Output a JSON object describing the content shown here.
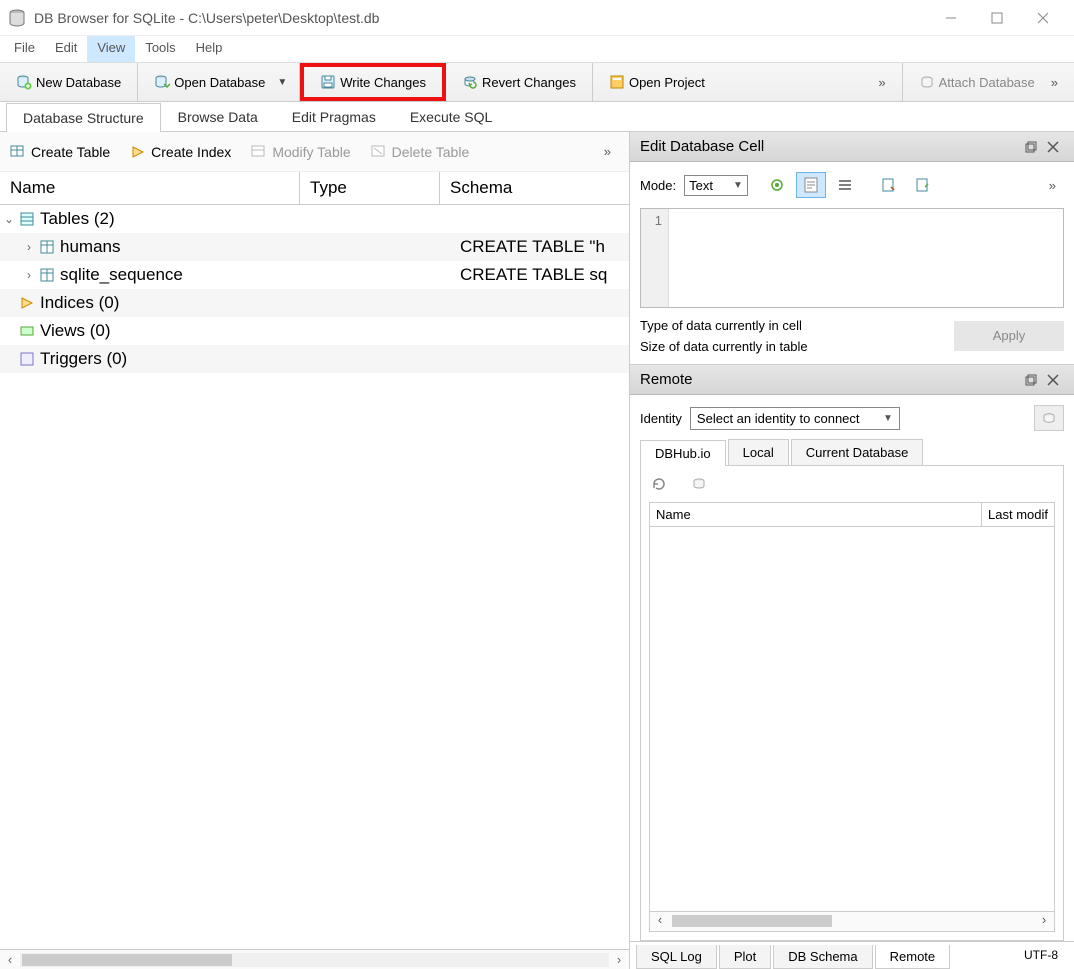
{
  "window": {
    "title": "DB Browser for SQLite - C:\\Users\\peter\\Desktop\\test.db"
  },
  "menu": {
    "file": "File",
    "edit": "Edit",
    "view": "View",
    "tools": "Tools",
    "help": "Help"
  },
  "toolbar": {
    "new_db": "New Database",
    "open_db": "Open Database",
    "write_changes": "Write Changes",
    "revert_changes": "Revert Changes",
    "open_project": "Open Project",
    "attach_db": "Attach Database"
  },
  "tabs": {
    "structure": "Database Structure",
    "browse": "Browse Data",
    "pragmas": "Edit Pragmas",
    "execute": "Execute SQL"
  },
  "subtoolbar": {
    "create_table": "Create Table",
    "create_index": "Create Index",
    "modify_table": "Modify Table",
    "delete_table": "Delete Table"
  },
  "tree": {
    "cols": {
      "name": "Name",
      "type": "Type",
      "schema": "Schema"
    },
    "tables_label": "Tables (2)",
    "humans": "humans",
    "humans_schema": "CREATE TABLE \"h",
    "sqlite_sequence": "sqlite_sequence",
    "sqlite_sequence_schema": "CREATE TABLE sq",
    "indices": "Indices (0)",
    "views": "Views (0)",
    "triggers": "Triggers (0)"
  },
  "editcell": {
    "title": "Edit Database Cell",
    "mode_label": "Mode:",
    "mode_value": "Text",
    "gutter_1": "1",
    "info_type": "Type of data currently in cell",
    "info_size": "Size of data currently in table",
    "apply": "Apply"
  },
  "remote": {
    "title": "Remote",
    "identity_label": "Identity",
    "identity_placeholder": "Select an identity to connect",
    "tabs": {
      "dbhub": "DBHub.io",
      "local": "Local",
      "current": "Current Database"
    },
    "list": {
      "name": "Name",
      "lastmod": "Last modif"
    }
  },
  "bottom_tabs": {
    "sql_log": "SQL Log",
    "plot": "Plot",
    "db_schema": "DB Schema",
    "remote": "Remote"
  },
  "status": {
    "encoding": "UTF-8"
  }
}
